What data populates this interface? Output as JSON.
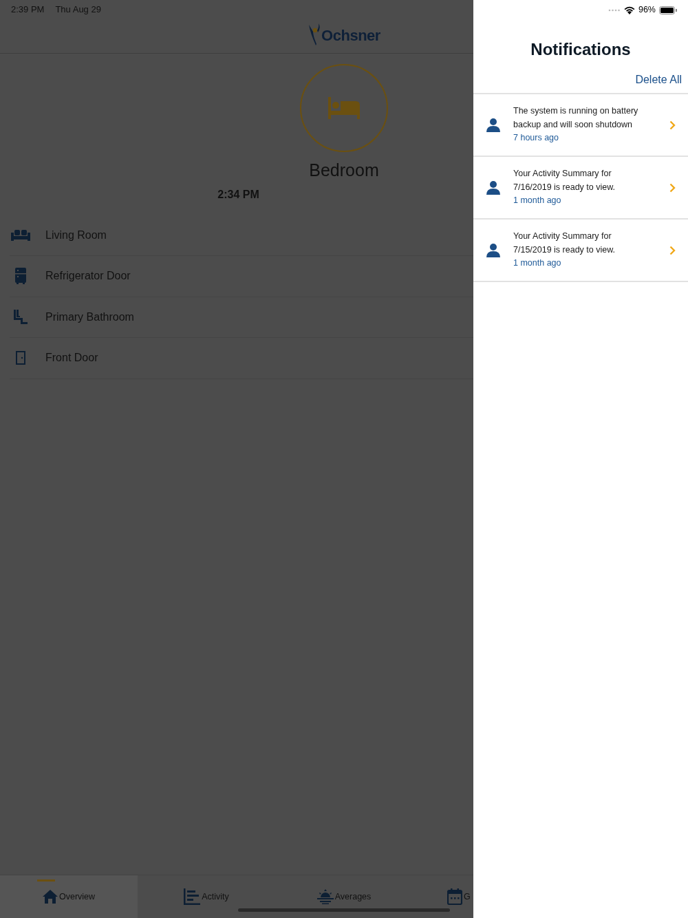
{
  "status_bar": {
    "time": "2:39 PM",
    "date": "Thu Aug 29",
    "battery": "96%"
  },
  "header": {
    "logo_text": "Ochsner"
  },
  "current_room": {
    "name": "Bedroom",
    "time": "2:34 PM"
  },
  "rooms": [
    {
      "name": "Living Room",
      "kind": "sofa"
    },
    {
      "name": "Refrigerator Door",
      "kind": "fridge"
    },
    {
      "name": "Primary Bathroom",
      "kind": "toilet"
    },
    {
      "name": "Front Door",
      "kind": "door"
    }
  ],
  "tabs": [
    {
      "label": "Overview",
      "kind": "home",
      "selected": true
    },
    {
      "label": "Activity",
      "kind": "activity",
      "selected": false
    },
    {
      "label": "Averages",
      "kind": "averages",
      "selected": false
    },
    {
      "label": "G",
      "kind": "calendar",
      "selected": false
    }
  ],
  "notifications": {
    "title": "Notifications",
    "delete_all": "Delete All",
    "items": [
      {
        "message": "The system is running on battery backup and will soon shutdown",
        "time": "7 hours ago"
      },
      {
        "message": "Your Activity Summary for 7/16/2019 is ready to view.",
        "time": "1 month ago"
      },
      {
        "message": "Your Activity Summary for 7/15/2019 is ready to view.",
        "time": "1 month ago"
      }
    ]
  }
}
